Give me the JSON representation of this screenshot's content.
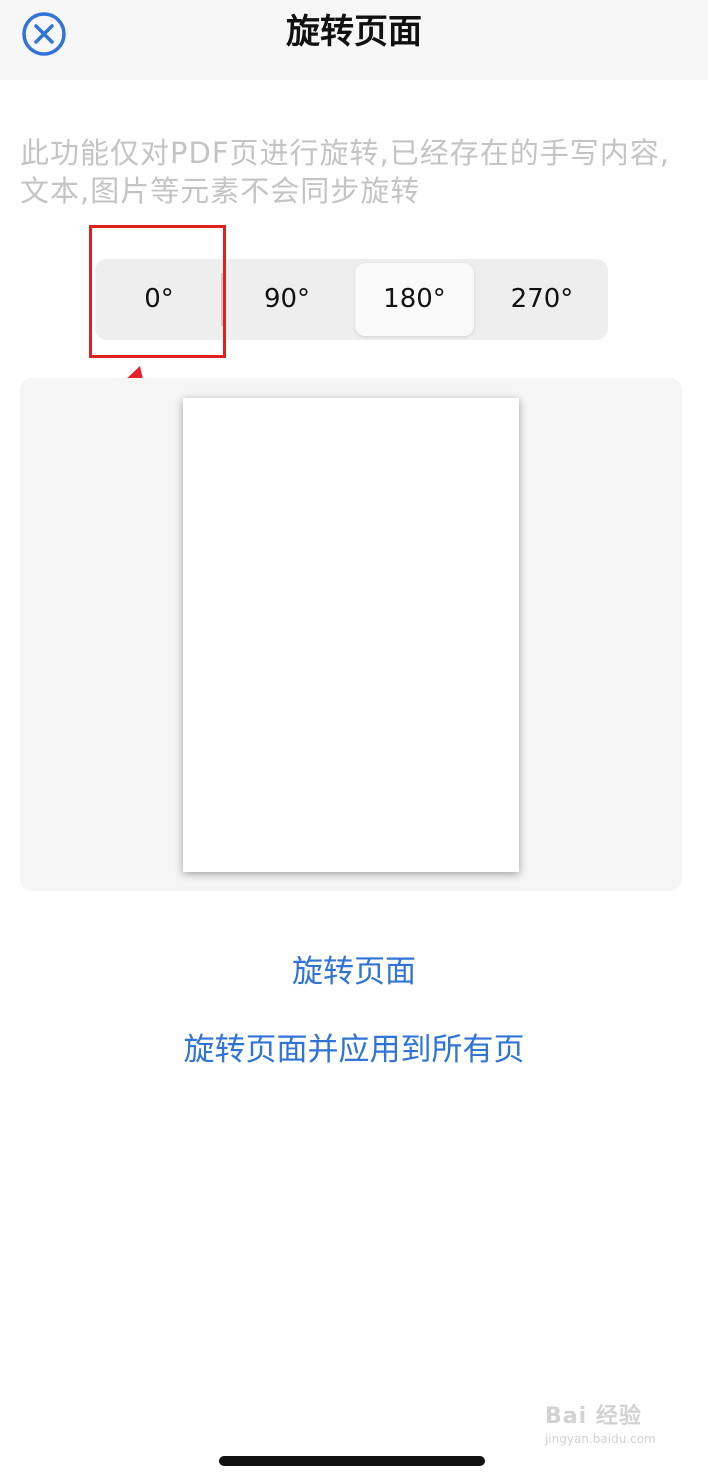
{
  "header": {
    "title": "旋转页面",
    "close_icon": "close-circle-icon",
    "accent_color": "#2f74d6"
  },
  "description": "此功能仅对PDF页进行旋转,已经存在的手写内容,文本,图片等元素不会同步旋转",
  "rotation": {
    "options": [
      "0°",
      "90°",
      "180°",
      "270°"
    ],
    "selected": "180°"
  },
  "actions": {
    "rotate_page": "旋转页面",
    "rotate_all": "旋转页面并应用到所有页"
  },
  "annotation": {
    "color": "#e02020"
  },
  "watermark": {
    "brand": "Bai 经验",
    "url": "jingyan.baidu.com"
  }
}
